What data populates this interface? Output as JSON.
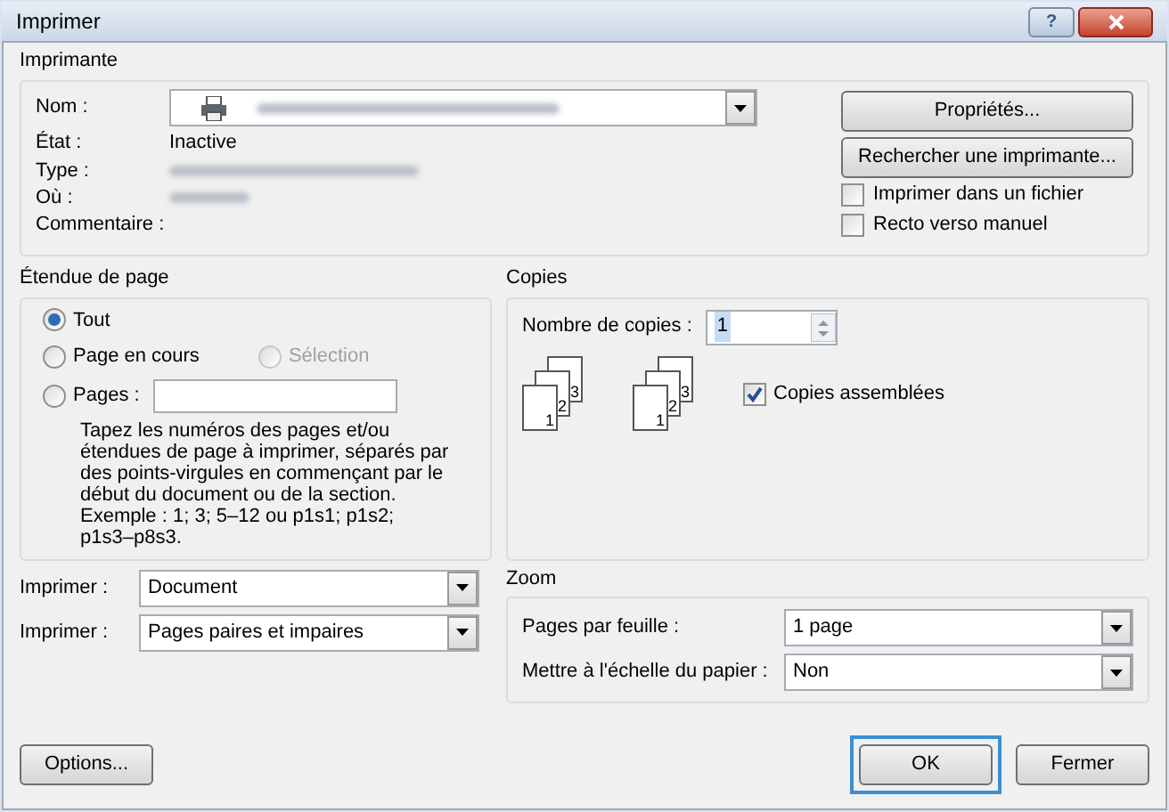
{
  "window": {
    "title": "Imprimer",
    "help_button": "?"
  },
  "printer": {
    "legend": "Imprimante",
    "name_label": "Nom :",
    "status_label": "État :",
    "status": "Inactive",
    "type_label": "Type :",
    "where_label": "Où :",
    "comment_label": "Commentaire :",
    "properties_button": "Propriétés...",
    "find_button": "Rechercher une imprimante...",
    "options": [
      {
        "label": "Imprimer dans un fichier",
        "checked": false
      },
      {
        "label": "Recto verso manuel",
        "checked": false
      }
    ]
  },
  "page_range": {
    "legend": "Étendue de page",
    "radios": [
      {
        "label": "Tout",
        "selected": true,
        "disabled": false
      },
      {
        "label": "Page en cours",
        "selected": false,
        "disabled": false
      },
      {
        "label": "Sélection",
        "selected": false,
        "disabled": true
      },
      {
        "label": "Pages :",
        "selected": false,
        "disabled": false
      }
    ],
    "help": "Tapez les numéros des pages et/ou étendues de page à imprimer, séparés par des points-virgules en commençant par le début du document ou de la section. Exemple : 1; 3; 5–12 ou p1s1; p1s2; p1s3–p8s3."
  },
  "copies": {
    "legend": "Copies",
    "count_label": "Nombre de copies :",
    "count": "1",
    "stacks": [
      [
        "1",
        "2",
        "3"
      ],
      [
        "1",
        "2",
        "3"
      ]
    ],
    "collate": {
      "label": "Copies assemblées",
      "checked": true
    }
  },
  "print_selects": [
    {
      "label": "Imprimer :",
      "value": "Document"
    },
    {
      "label": "Imprimer :",
      "value": "Pages paires et impaires"
    }
  ],
  "zoom": {
    "legend": "Zoom",
    "rows": [
      {
        "label": "Pages par feuille :",
        "value": "1 page"
      },
      {
        "label": "Mettre à l'échelle du papier :",
        "value": "Non"
      }
    ]
  },
  "buttons": {
    "options": "Options...",
    "ok": "OK",
    "close": "Fermer"
  }
}
